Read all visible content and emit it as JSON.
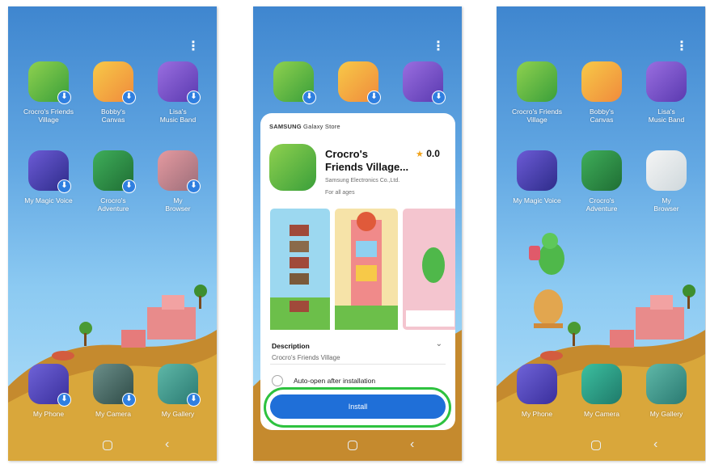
{
  "menu_icon": "⋮",
  "home_apps_top": [
    {
      "label": "Crocro's Friends\nVillage",
      "icon": "crocodile-house-icon"
    },
    {
      "label": "Bobby's\nCanvas",
      "icon": "pig-painter-icon"
    },
    {
      "label": "Lisa's\nMusic Band",
      "icon": "koala-singer-icon"
    },
    {
      "label": "My Magic Voice",
      "icon": "koala-magician-icon"
    },
    {
      "label": "Crocro's\nAdventure",
      "icon": "crocodile-adventure-icon"
    },
    {
      "label": "My\nBrowser",
      "icon": "cat-wizard-icon"
    }
  ],
  "home_apps_bottom": [
    {
      "label": "My Phone",
      "icon": "koala-phone-icon"
    },
    {
      "label": "My Camera",
      "icon": "panda-camera-icon"
    },
    {
      "label": "My Gallery",
      "icon": "photo-gallery-icon"
    }
  ],
  "download_badge": "⬇",
  "nav": {
    "home_icon": "home-button-icon",
    "back_glyph": "‹"
  },
  "store": {
    "brand": "SAMSUNG",
    "name": "Galaxy Store",
    "app_title": "Crocro's\nFriends Village...",
    "star": "★",
    "rating": "0.0",
    "developer": "Samsung Electronics Co.,Ltd.",
    "age": "For all ages",
    "description_title": "Description",
    "description_text": "Crocro's Friends Village",
    "description_chevron": "⌄",
    "auto_open_label": "Auto-open after installation",
    "install_label": "Install"
  },
  "colors": {
    "install_button": "#1f6fd8",
    "highlight": "#2ec23f",
    "download_badge": "#2f7fe0",
    "rating_star": "#f0a21a"
  }
}
